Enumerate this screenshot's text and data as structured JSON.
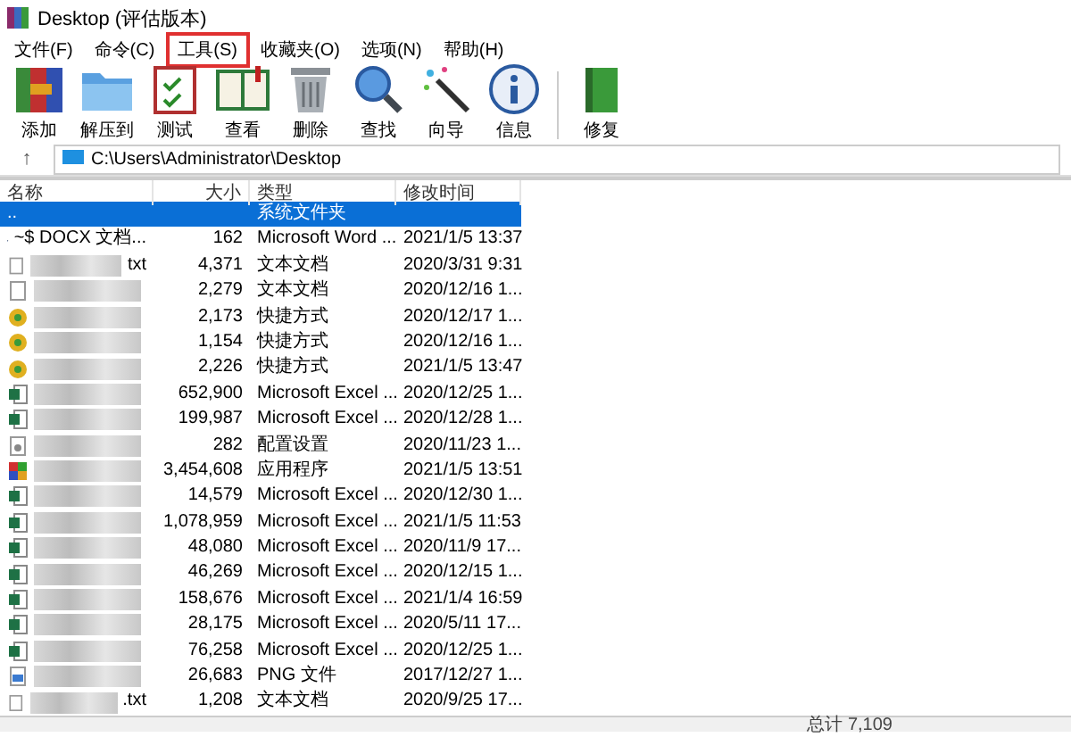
{
  "window": {
    "title": "Desktop (评估版本)"
  },
  "menu": [
    {
      "label": "文件(F)",
      "highlighted": false
    },
    {
      "label": "命令(C)",
      "highlighted": false
    },
    {
      "label": "工具(S)",
      "highlighted": true
    },
    {
      "label": "收藏夹(O)",
      "highlighted": false
    },
    {
      "label": "选项(N)",
      "highlighted": false
    },
    {
      "label": "帮助(H)",
      "highlighted": false
    }
  ],
  "toolbar": [
    {
      "label": "添加",
      "kind": "archive"
    },
    {
      "label": "解压到",
      "kind": "folder"
    },
    {
      "label": "测试",
      "kind": "clipboard"
    },
    {
      "label": "查看",
      "kind": "book"
    },
    {
      "label": "删除",
      "kind": "trash"
    },
    {
      "label": "查找",
      "kind": "magnifier"
    },
    {
      "label": "向导",
      "kind": "wand"
    },
    {
      "label": "信息",
      "kind": "info"
    },
    {
      "label": "修复",
      "kind": "repair"
    }
  ],
  "address": {
    "up_button": "↑",
    "path": "C:\\Users\\Administrator\\Desktop"
  },
  "table": {
    "columns": [
      "名称",
      "大小",
      "类型",
      "修改时间"
    ],
    "rows": [
      {
        "name": "..",
        "blurred": false,
        "kind": "parent",
        "size": "",
        "type": "系统文件夹",
        "date": "",
        "selected": true
      },
      {
        "name": "~$ DOCX 文档...",
        "blurred": false,
        "kind": "word",
        "size": "162",
        "type": "Microsoft Word ...",
        "date": "2021/1/5 13:37",
        "selected": false
      },
      {
        "name": "txt",
        "blurred": true,
        "kind": "text",
        "size": "4,371",
        "type": "文本文档",
        "date": "2020/3/31 9:31",
        "selected": false
      },
      {
        "name": "",
        "blurred": true,
        "kind": "text",
        "size": "2,279",
        "type": "文本文档",
        "date": "2020/12/16 1...",
        "selected": false
      },
      {
        "name": "",
        "blurred": true,
        "kind": "shortcut",
        "size": "2,173",
        "type": "快捷方式",
        "date": "2020/12/17 1...",
        "selected": false
      },
      {
        "name": "",
        "blurred": true,
        "kind": "shortcut",
        "size": "1,154",
        "type": "快捷方式",
        "date": "2020/12/16 1...",
        "selected": false
      },
      {
        "name": "",
        "blurred": true,
        "kind": "shortcut",
        "size": "2,226",
        "type": "快捷方式",
        "date": "2021/1/5 13:47",
        "selected": false
      },
      {
        "name": "",
        "blurred": true,
        "kind": "excel",
        "size": "652,900",
        "type": "Microsoft Excel ...",
        "date": "2020/12/25 1...",
        "selected": false
      },
      {
        "name": "",
        "blurred": true,
        "kind": "excel",
        "size": "199,987",
        "type": "Microsoft Excel ...",
        "date": "2020/12/28 1...",
        "selected": false
      },
      {
        "name": "",
        "blurred": true,
        "kind": "config",
        "size": "282",
        "type": "配置设置",
        "date": "2020/11/23 1...",
        "selected": false
      },
      {
        "name": "",
        "blurred": true,
        "kind": "app",
        "size": "3,454,608",
        "type": "应用程序",
        "date": "2021/1/5 13:51",
        "selected": false
      },
      {
        "name": "",
        "blurred": true,
        "kind": "excel",
        "size": "14,579",
        "type": "Microsoft Excel ...",
        "date": "2020/12/30 1...",
        "selected": false
      },
      {
        "name": "",
        "blurred": true,
        "kind": "excel",
        "size": "1,078,959",
        "type": "Microsoft Excel ...",
        "date": "2021/1/5 11:53",
        "selected": false
      },
      {
        "name": "",
        "blurred": true,
        "kind": "excel",
        "size": "48,080",
        "type": "Microsoft Excel ...",
        "date": "2020/11/9 17...",
        "selected": false
      },
      {
        "name": "",
        "blurred": true,
        "kind": "excel",
        "size": "46,269",
        "type": "Microsoft Excel ...",
        "date": "2020/12/15 1...",
        "selected": false
      },
      {
        "name": "",
        "blurred": true,
        "kind": "excel",
        "size": "158,676",
        "type": "Microsoft Excel ...",
        "date": "2021/1/4 16:59",
        "selected": false
      },
      {
        "name": "",
        "blurred": true,
        "kind": "excel",
        "size": "28,175",
        "type": "Microsoft Excel ...",
        "date": "2020/5/11 17...",
        "selected": false
      },
      {
        "name": "",
        "blurred": true,
        "kind": "excel",
        "size": "76,258",
        "type": "Microsoft Excel ...",
        "date": "2020/12/25 1...",
        "selected": false
      },
      {
        "name": "",
        "blurred": true,
        "kind": "image",
        "size": "26,683",
        "type": "PNG 文件",
        "date": "2017/12/27 1...",
        "selected": false
      },
      {
        "name": ".txt",
        "blurred": true,
        "kind": "text",
        "size": "1,208",
        "type": "文本文档",
        "date": "2020/9/25 17...",
        "selected": false
      }
    ]
  },
  "status_bar": {
    "summary": "总计 7,109"
  }
}
